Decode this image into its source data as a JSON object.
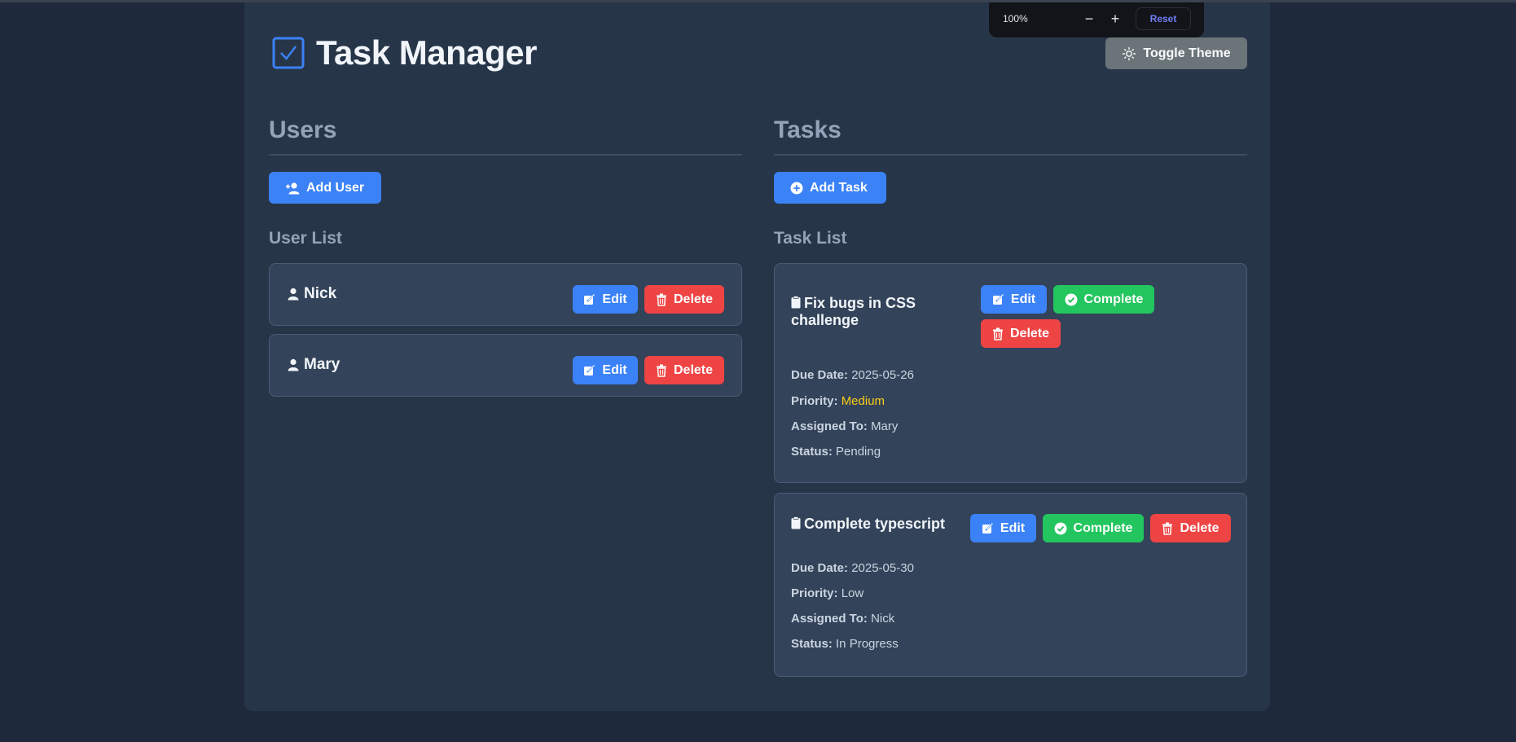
{
  "zoom": {
    "level": "100%",
    "minus": "−",
    "plus": "+",
    "reset": "Reset"
  },
  "header": {
    "title": "Task Manager",
    "toggle_theme": "Toggle Theme"
  },
  "users": {
    "section_title": "Users",
    "add_button": "Add User",
    "list_title": "User List",
    "items": [
      {
        "name": "Nick",
        "edit": "Edit",
        "delete": "Delete"
      },
      {
        "name": "Mary",
        "edit": "Edit",
        "delete": "Delete"
      }
    ]
  },
  "tasks": {
    "section_title": "Tasks",
    "add_button": "Add Task",
    "list_title": "Task List",
    "labels": {
      "due": "Due Date:",
      "priority": "Priority:",
      "assigned": "Assigned To:",
      "status": "Status:"
    },
    "items": [
      {
        "title_line1": "Fix bugs in CSS",
        "title_line2": "challenge",
        "edit": "Edit",
        "complete": "Complete",
        "delete": "Delete",
        "due": "2025-05-26",
        "priority": "Medium",
        "assigned": "Mary",
        "status": "Pending"
      },
      {
        "title": "Complete typescript",
        "edit": "Edit",
        "complete": "Complete",
        "delete": "Delete",
        "due": "2025-05-30",
        "priority": "Low",
        "assigned": "Nick",
        "status": "In Progress"
      }
    ]
  },
  "colors": {
    "background": "#1e293b",
    "panel": "#273548",
    "card": "#334359",
    "primary": "#3b82f6",
    "danger": "#ef4444",
    "success": "#22c55e",
    "warning": "#facc15"
  }
}
